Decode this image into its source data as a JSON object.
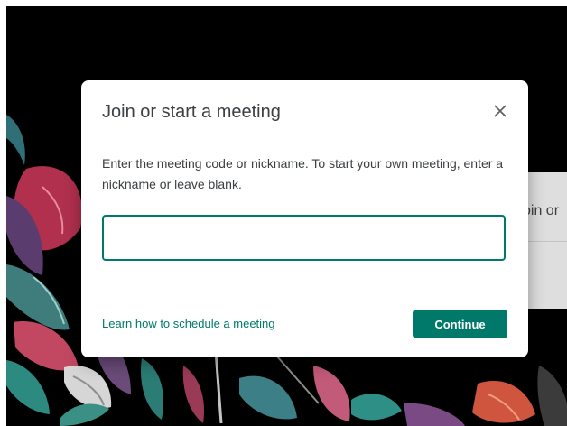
{
  "background": {
    "panel_text": "oin or"
  },
  "dialog": {
    "title": "Join or start a meeting",
    "close_icon": "close-icon",
    "description": "Enter the meeting code or nickname. To start your own meeting, enter a nickname or leave blank.",
    "input_value": "",
    "input_placeholder": "",
    "learn_link_label": "Learn how to schedule a meeting",
    "continue_label": "Continue"
  },
  "colors": {
    "accent": "#00796b",
    "backdrop": "#000000",
    "dialog_bg": "#ffffff",
    "text": "#3c4043"
  }
}
